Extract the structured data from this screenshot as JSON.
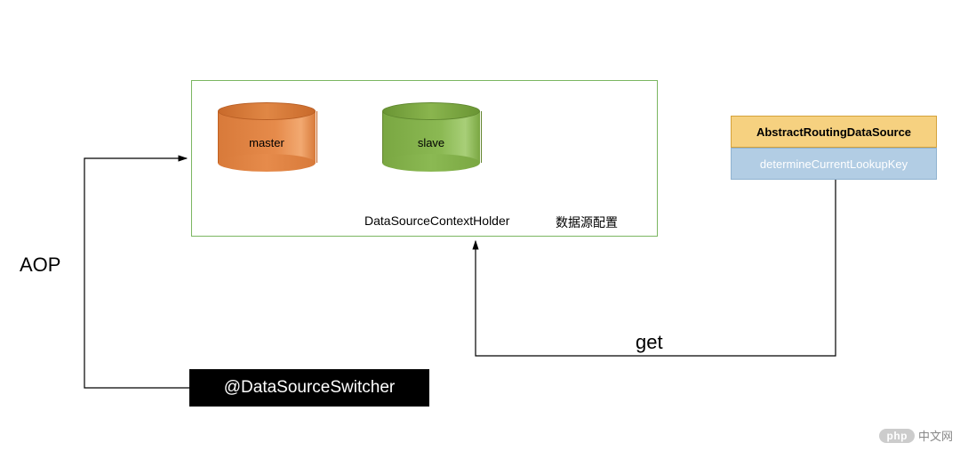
{
  "diagram": {
    "aop_label": "AOP",
    "switcher_label": "@DataSourceSwitcher",
    "holder_label": "DataSourceContextHolder",
    "config_label": "数据源配置",
    "master_label": "master",
    "slave_label": "slave",
    "abstract_routing_label": "AbstractRoutingDataSource",
    "determine_key_label": "determineCurrentLookupKey",
    "get_label": "get"
  },
  "watermark": {
    "badge": "php",
    "text": "中文网"
  }
}
